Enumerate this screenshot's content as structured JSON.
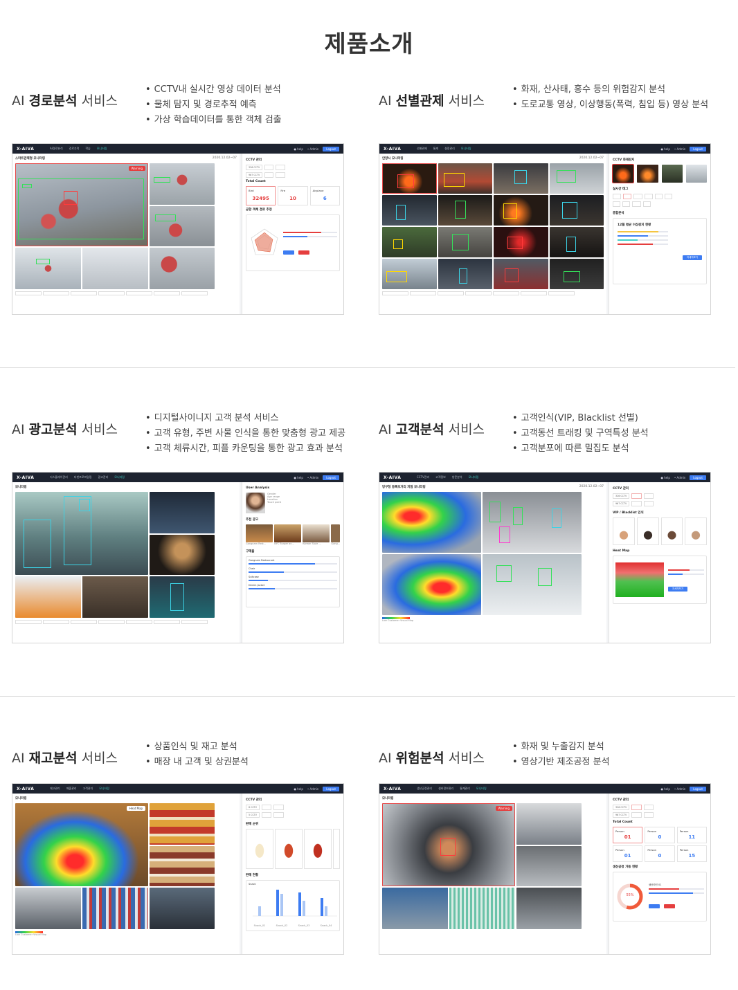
{
  "page": {
    "title": "제품소개"
  },
  "colors": {
    "accent": "#3d7cf2",
    "warning": "#e53e3e",
    "nav_bg": "#1d2330",
    "active_menu": "#41d1c6"
  },
  "mock_common": {
    "logo": "X-AIVA",
    "help": "● help",
    "admin": "• Admin",
    "login": "Logout"
  },
  "services": [
    {
      "prefix": "AI ",
      "bold": "경로분석",
      "suffix": " 서비스",
      "bullets": [
        "CCTV내 실시간 영상 데이터 분석",
        "물체 탐지 및 경로추적 예측",
        "가상 학습데이터를 통한 객체 검출"
      ],
      "menu": [
        "AI경로분석",
        "경로추적",
        "학습",
        "모니터링"
      ],
      "screen_title": "스마트관제형 모니터링",
      "date": "2020.12.02~07",
      "warning": "Warning",
      "side_titles": [
        "CCTV 관리",
        "Total Count",
        "공항 객체 경로 추정"
      ],
      "counts": [
        {
          "label": "Bird",
          "value": "32495"
        },
        {
          "label": "Fire",
          "value": "10"
        },
        {
          "label": "Airplane",
          "value": "6"
        }
      ],
      "cctv": [
        "326 CCTV",
        "967 CCTV"
      ]
    },
    {
      "prefix": "AI ",
      "bold": "선별관제",
      "suffix": " 서비스",
      "bullets": [
        "화재, 산사태, 홍수 등의 위험감지 분석",
        "도로교통 영상, 이상행동(폭력, 침입 등) 영상 분석"
      ],
      "menu": [
        "선별관제",
        "통계",
        "설정관리",
        "모니터링"
      ],
      "screen_title": "안양시 모니터링",
      "date": "2020.12.02~07",
      "side_titles": [
        "CCTV 화재감지",
        "실시간 태그",
        "종합분석"
      ],
      "panel_title": "12월 평균 이상감지 현황",
      "panel_button": "자세히보기"
    },
    {
      "prefix": "AI ",
      "bold": "광고분석",
      "suffix": " 서비스",
      "bullets": [
        "디지털사이니지 고객 분석 서비스",
        "고객 유형, 주변 사물 인식을 통한 맞춤형 광고 제공",
        "고객 체류시간, 피플 카운팅을 통한 광고 효과 분석"
      ],
      "menu": [
        "디스플레이관리",
        "타겟프로파일링",
        "광고관리",
        "모니터링"
      ],
      "screen_title": "모니터링",
      "side_titles": [
        "User Analysis",
        "추천 광고",
        "구매율"
      ],
      "user_fields": [
        "Gender",
        "Age range",
        "Location",
        "Touch point"
      ],
      "ads": [
        "Gangnam Rest...",
        "NYC Burger an...",
        "Korean Style ...",
        "Gang..."
      ],
      "purchase": [
        "Gangnam Restaurant",
        "Chair",
        "Suitcase",
        "Denim Jacket"
      ]
    },
    {
      "prefix": "AI ",
      "bold": "고객분석",
      "suffix": " 서비스",
      "bullets": [
        "고객인식(VIP, Blacklist 선별)",
        "고객동선 트래킹 및 구역특성 분석",
        "고객분포에 따른 밀집도 분석"
      ],
      "menu": [
        "CCTV관리",
        "고객정보",
        "방문분석",
        "모니터링"
      ],
      "screen_title": "방구청 등록오거리 지점 모니터링",
      "date": "2020.12.02~07",
      "side_titles": [
        "CCTV 관리",
        "VIP / Blacklist 인식",
        "Heat Map"
      ],
      "cctv": [
        "326 CCTV",
        "967 CCTV"
      ],
      "heatmap_button": "자세히보기",
      "legend": "Low Customer Visual Map"
    },
    {
      "prefix": "AI ",
      "bold": "재고분석",
      "suffix": " 서비스",
      "bullets": [
        "상품인식 및 재고 분석",
        "매장 내 고객 및 상권분석"
      ],
      "menu": [
        "재고관리",
        "매출관리",
        "고객관리",
        "모니터링"
      ],
      "screen_title": "모니터링",
      "heatmap_label": "Heat Map",
      "side_titles": [
        "CCTV 관리",
        "판매 순위",
        "판매 현황"
      ],
      "cctv": [
        "8 CCTV",
        "5 CCTV"
      ],
      "chart_label": "Snack",
      "chart_categories": [
        "Snack_01",
        "Snack_02",
        "Snack_03",
        "Snack_04"
      ],
      "legend": "Low Customer Visual Map"
    },
    {
      "prefix": "AI ",
      "bold": "위험분석",
      "suffix": " 서비스",
      "bullets": [
        "화재 및 누출감지 분석",
        "영상기반 제조공정 분석"
      ],
      "menu": [
        "생산공정관리",
        "설비정보관리",
        "통계관리",
        "모니터링"
      ],
      "screen_title": "모니터링",
      "warning": "Warning",
      "side_titles": [
        "CCTV 관리",
        "Total Count",
        "생산공정 가동 현황"
      ],
      "cctv": [
        "326 CCTV",
        "967 CCTV"
      ],
      "counts": [
        {
          "label": "Person",
          "value": "01"
        },
        {
          "label": "Person",
          "value": "0"
        },
        {
          "label": "Person",
          "value": "11"
        },
        {
          "label": "Person",
          "value": "01"
        },
        {
          "label": "Person",
          "value": "0"
        },
        {
          "label": "Person",
          "value": "15"
        }
      ],
      "gauge": "55%",
      "gauge_label": "생산라인 01"
    }
  ]
}
